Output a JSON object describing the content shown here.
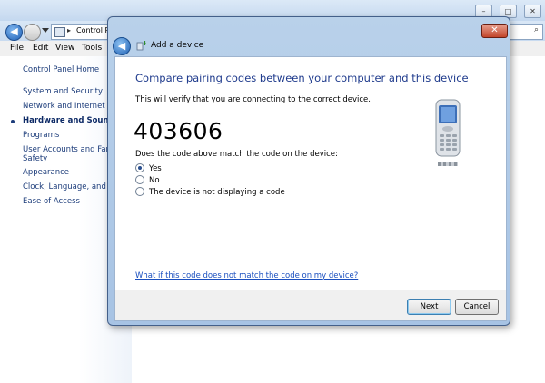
{
  "background": {
    "address_text": "Control P",
    "menu": [
      "File",
      "Edit",
      "View",
      "Tools"
    ],
    "left_pane": [
      {
        "label": "Control Panel Home",
        "active": false
      },
      {
        "label": "System and Security",
        "active": false
      },
      {
        "label": "Network and Internet",
        "active": false
      },
      {
        "label": "Hardware and Sound",
        "active": true
      },
      {
        "label": "Programs",
        "active": false
      },
      {
        "label": "User Accounts and Famil",
        "active": false
      },
      {
        "label": "Safety",
        "active": false
      },
      {
        "label": "Appearance",
        "active": false
      },
      {
        "label": "Clock, Language, and Re",
        "active": false
      },
      {
        "label": "Ease of Access",
        "active": false
      }
    ]
  },
  "dialog": {
    "title": "Add a device",
    "close_glyph": "✕",
    "heading": "Compare pairing codes between your computer and this device",
    "description": "This will verify that you are connecting to the correct device.",
    "code": "403606",
    "question": "Does the code above match the code on the device:",
    "options": [
      {
        "label": "Yes",
        "checked": true
      },
      {
        "label": "No",
        "checked": false
      },
      {
        "label": "The device is not displaying a code",
        "checked": false
      }
    ],
    "help_link": "What if this code does not match the code on my device?",
    "next_label": "Next",
    "cancel_label": "Cancel"
  },
  "colors": {
    "heading": "#1e3a8c",
    "link": "#1a4fbf",
    "frame": "#a7c3e4"
  },
  "icons": [
    "back-arrow-icon",
    "forward-arrow-icon",
    "add-device-icon",
    "search-icon",
    "mobile-phone-icon",
    "control-panel-icon"
  ]
}
